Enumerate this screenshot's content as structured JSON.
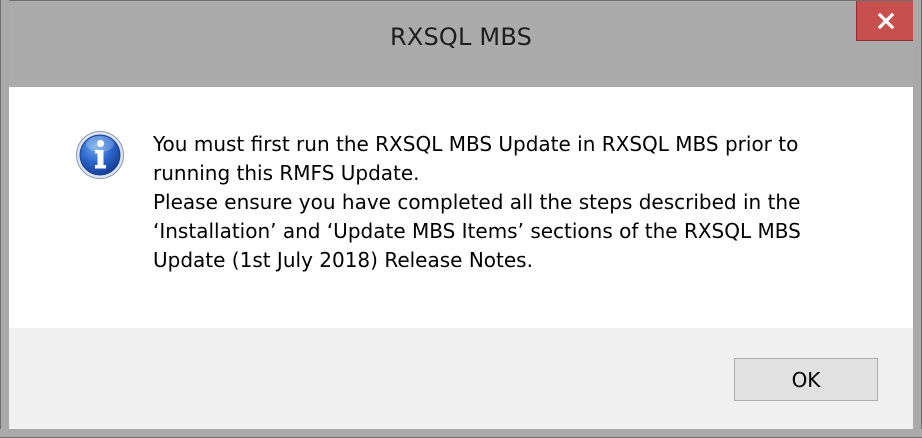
{
  "window": {
    "title": "RXSQL MBS",
    "close_label": "x"
  },
  "dialog": {
    "icon": "information-icon",
    "message_lines": [
      "You must first run the RXSQL MBS Update in RXSQL MBS prior to",
      "running this RMFS Update.",
      "Please ensure you have completed all the steps described in the",
      "‘Installation’ and ‘Update MBS Items’ sections of the RXSQL MBS",
      "Update (1st July 2018) Release Notes."
    ],
    "ok_label": "OK"
  },
  "colors": {
    "titlebar": "#ababab",
    "close_button": "#c7504f",
    "button_panel": "#f0f0f0",
    "info_icon_blue": "#1f5bbf"
  }
}
